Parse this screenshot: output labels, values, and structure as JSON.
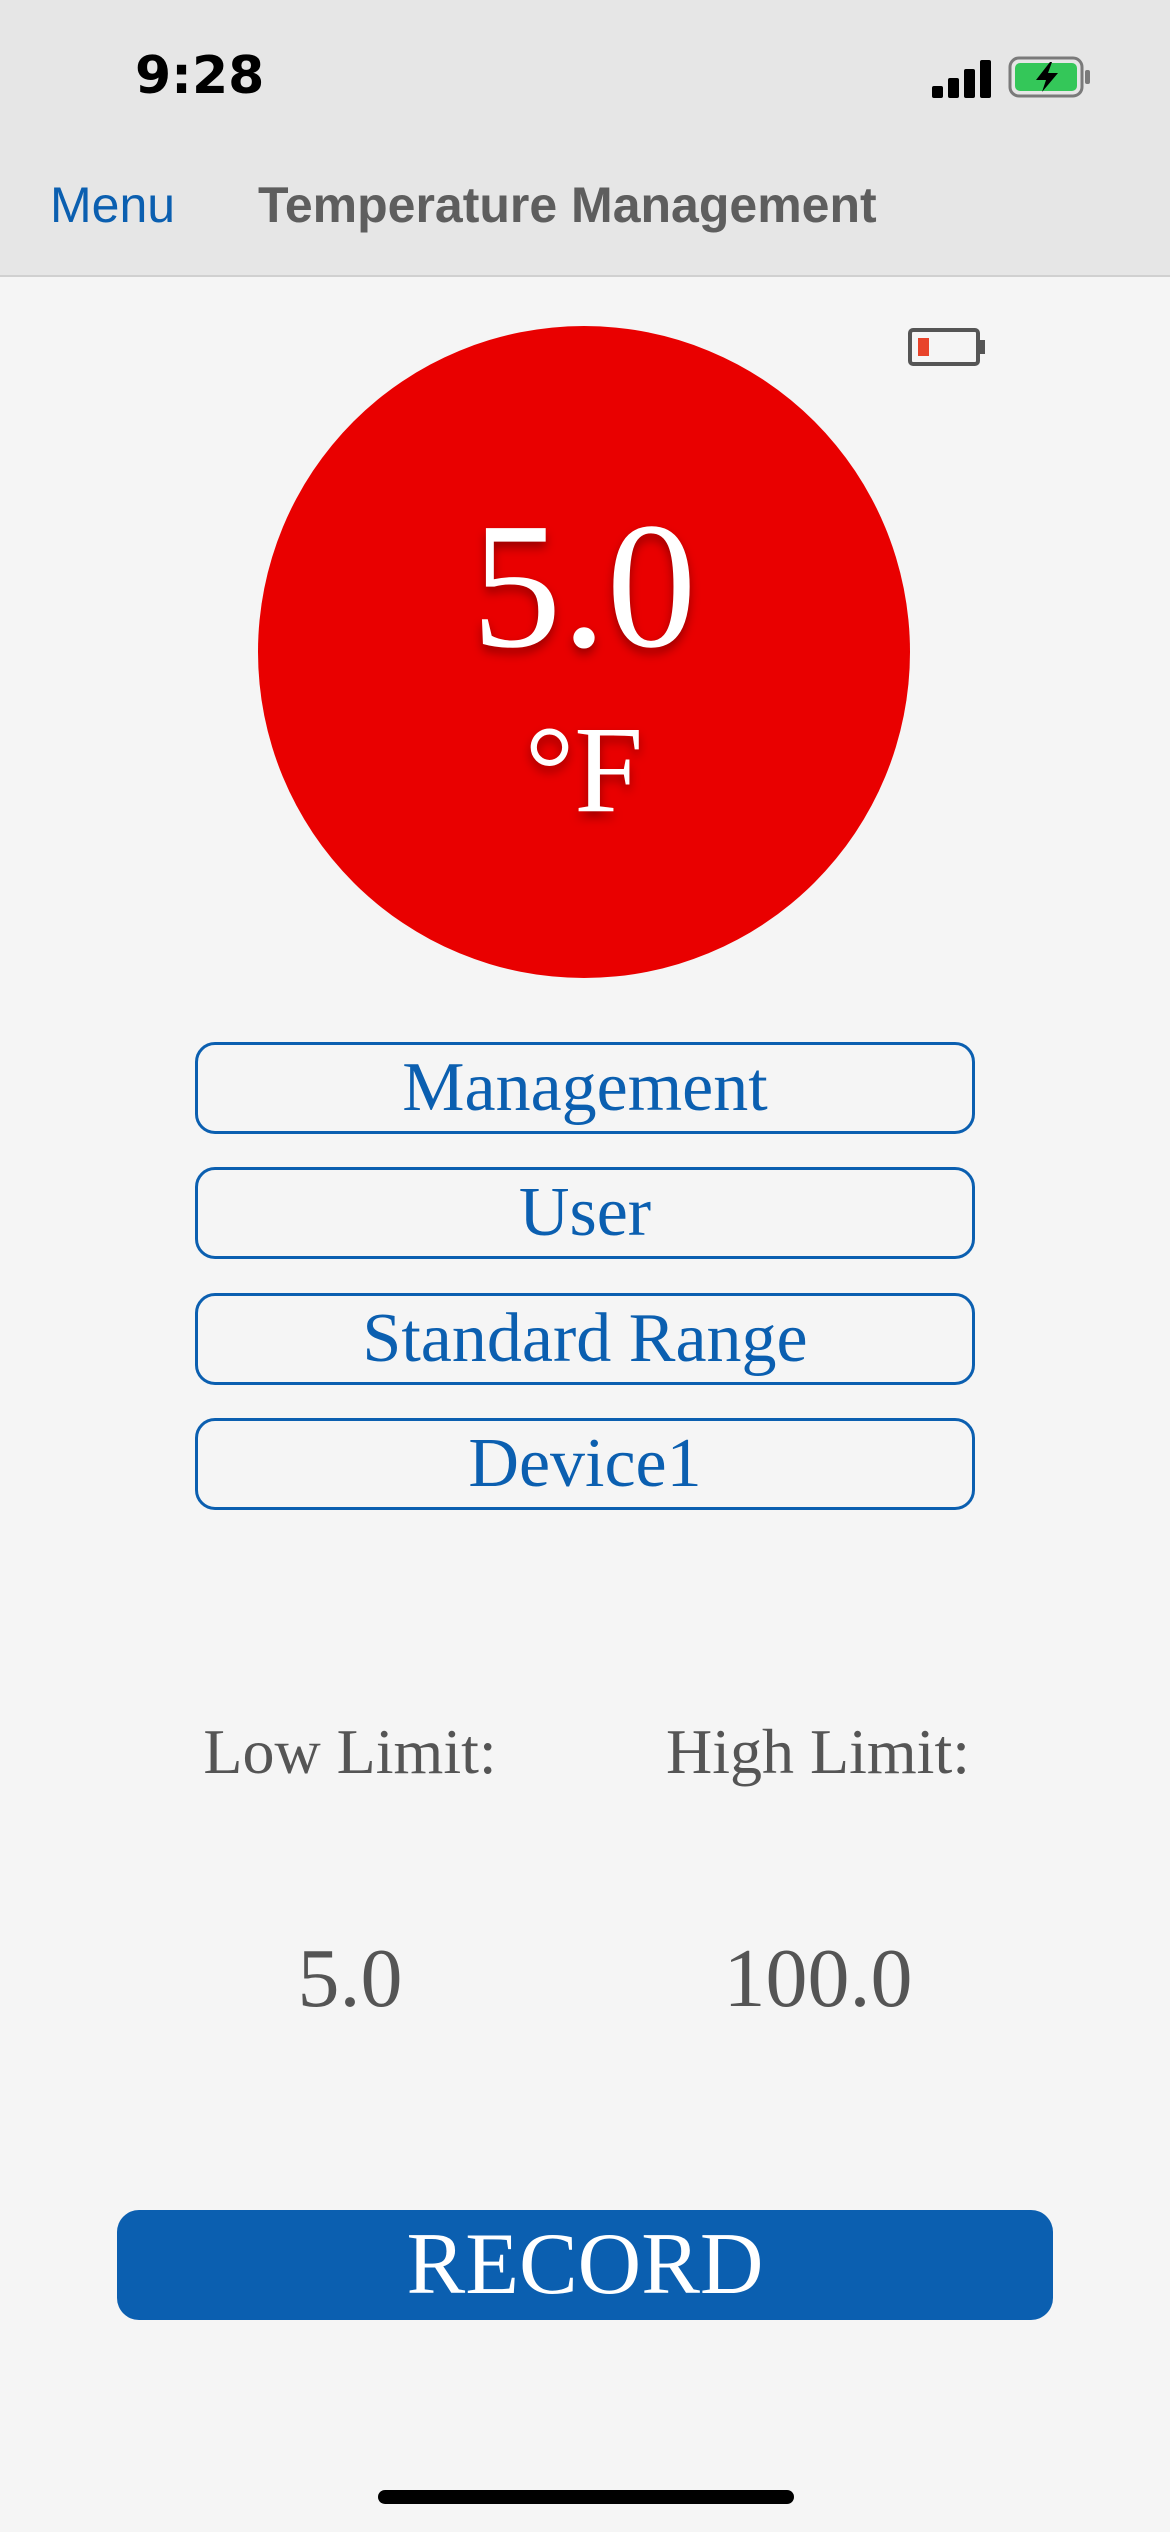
{
  "status_bar": {
    "time": "9:28",
    "signal_icon": "cellular-signal-icon",
    "battery_icon": "battery-charging-icon",
    "battery_color": "#34c759"
  },
  "nav": {
    "menu_label": "Menu",
    "title": "Temperature Management"
  },
  "device": {
    "battery_icon": "battery-low-icon",
    "battery_level_color": "#e8432a"
  },
  "reading": {
    "value": "5.0",
    "unit": "°F",
    "circle_color": "#e90000"
  },
  "buttons": {
    "management": "Management",
    "user": "User",
    "standard_range": "Standard Range",
    "device": "Device1",
    "record": "RECORD"
  },
  "limits": {
    "low_label": "Low Limit:",
    "high_label": "High Limit:",
    "low_value": "5.0",
    "high_value": "100.0"
  },
  "colors": {
    "accent": "#0b5fb0",
    "background": "#f5f5f5",
    "header_background": "#e6e6e6"
  }
}
